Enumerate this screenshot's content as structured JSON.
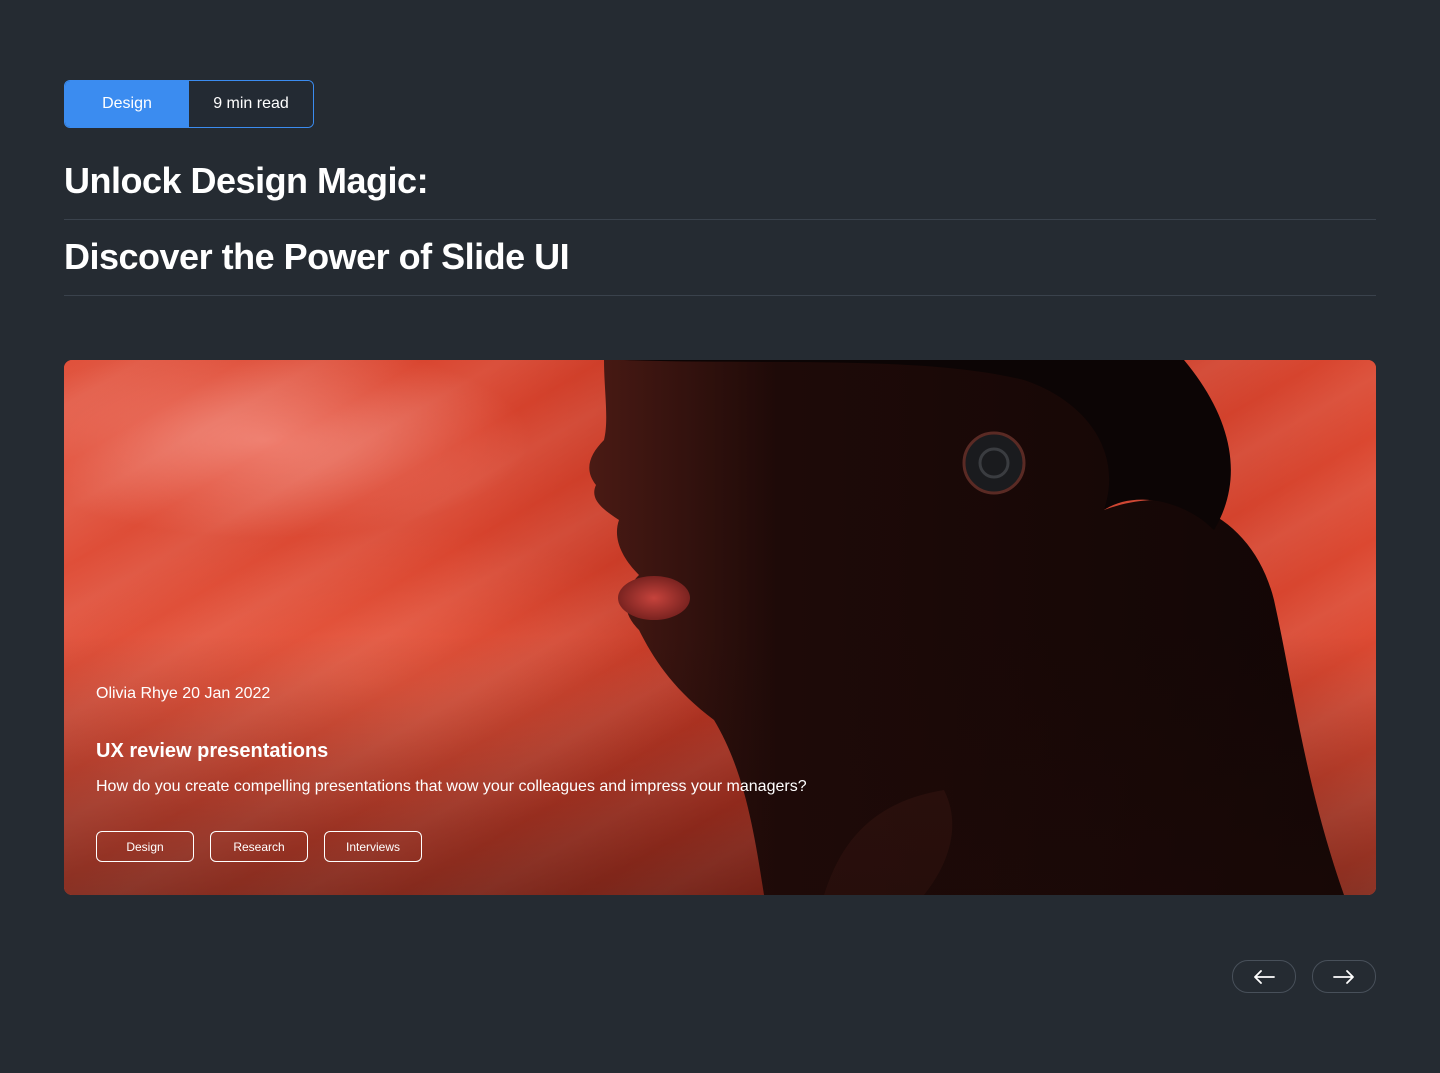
{
  "header": {
    "category": "Design",
    "read_time": "9 min read",
    "title_line_1": "Unlock Design Magic:",
    "title_line_2": "Discover the Power of Slide UI"
  },
  "hero": {
    "author_date": "Olivia Rhye 20 Jan 2022",
    "title": "UX review presentations",
    "description": "How do you create compelling presentations that wow your colleagues and impress your managers?",
    "tags": [
      "Design",
      "Research",
      "Interviews"
    ],
    "image": "portrait-red-fabric"
  },
  "navigation": {
    "prev_icon": "arrow-left-icon",
    "next_icon": "arrow-right-icon"
  },
  "colors": {
    "background": "#252b32",
    "accent": "#3b8cf0",
    "hero_red": "#d2402a"
  }
}
